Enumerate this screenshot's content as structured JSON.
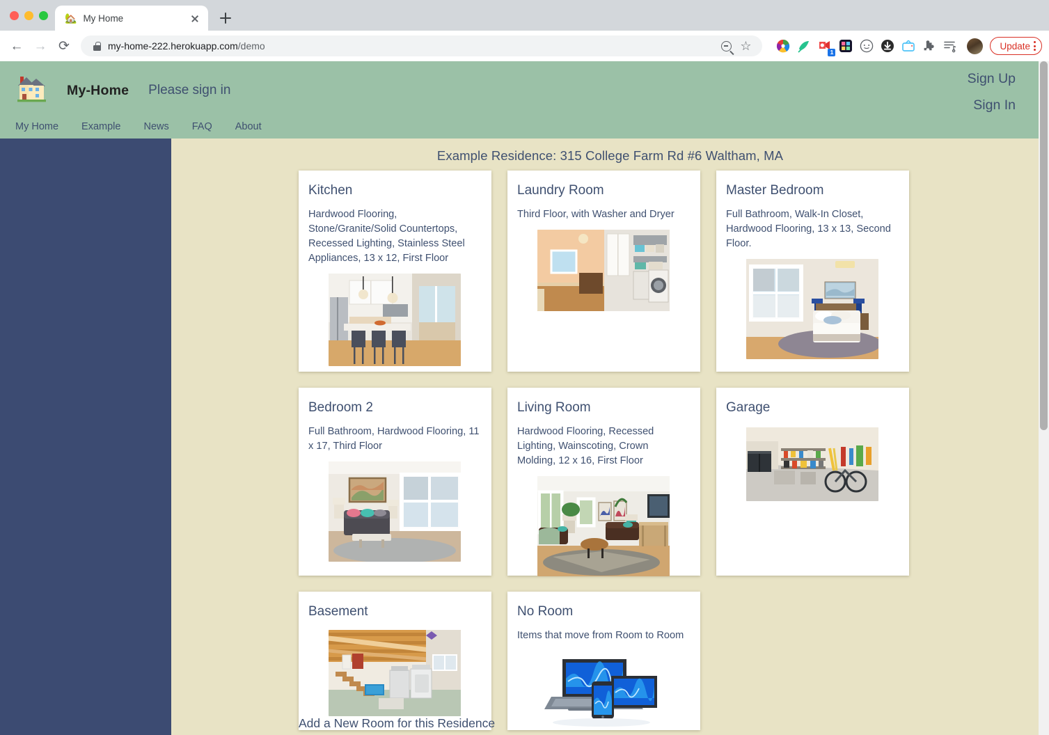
{
  "browser": {
    "tab": {
      "title": "My Home",
      "favicon": "house-icon"
    },
    "new_tab_label": "+",
    "back_label": "←",
    "forward_label": "→",
    "reload_label": "⟳",
    "url_main": "my-home-222.herokuapp.com",
    "url_path": "/demo",
    "update_button": "Update",
    "extensions": [
      "color-wheel-icon",
      "green-bird-icon",
      "red-video-icon",
      "grid-colors-icon",
      "circle-face-icon",
      "download-icon",
      "tv-icon",
      "puzzle-piece-icon",
      "playlist-icon"
    ],
    "extension_badge": "1",
    "avatar": "user-avatar"
  },
  "site": {
    "logo": "house-icon",
    "brand": "My-Home",
    "signin_note": "Please sign in",
    "auth": [
      {
        "label": "Sign Up",
        "name": "sign-up-link"
      },
      {
        "label": "Sign In",
        "name": "sign-in-link"
      }
    ],
    "nav": [
      {
        "label": "My Home",
        "name": "nav-my-home"
      },
      {
        "label": "Example",
        "name": "nav-example"
      },
      {
        "label": "News",
        "name": "nav-news"
      },
      {
        "label": "FAQ",
        "name": "nav-faq"
      },
      {
        "label": "About",
        "name": "nav-about"
      }
    ]
  },
  "main": {
    "page_title": "Example Residence: 315 College Farm Rd #6 Waltham, MA",
    "add_room_link": "Add a New Room for this Residence",
    "rooms": [
      {
        "title": "Kitchen",
        "desc": "Hardwood Flooring, Stone/Granite/Solid Countertops, Recessed Lighting, Stainless Steel Appliances, 13 x 12, First Floor",
        "image": "kitchen-photo"
      },
      {
        "title": "Laundry Room",
        "desc": "Third Floor, with Washer and Dryer",
        "image": "laundry-room-photo"
      },
      {
        "title": "Master Bedroom",
        "desc": "Full Bathroom, Walk-In Closet, Hardwood Flooring, 13 x 13, Second Floor.",
        "image": "master-bedroom-photo"
      },
      {
        "title": "Bedroom 2",
        "desc": "Full Bathroom, Hardwood Flooring, 11 x 17, Third Floor",
        "image": "bedroom-2-photo"
      },
      {
        "title": "Living Room",
        "desc": "Hardwood Flooring, Recessed Lighting, Wainscoting, Crown Molding, 12 x 16, First Floor",
        "image": "living-room-photo"
      },
      {
        "title": "Garage",
        "desc": "",
        "image": "garage-photo"
      },
      {
        "title": "Basement",
        "desc": "",
        "image": "basement-photo"
      },
      {
        "title": "No Room",
        "desc": "Items that move from Room to Room",
        "image": "devices-photo"
      }
    ]
  },
  "colors": {
    "header_green": "#9bc1a7",
    "sidebar_blue": "#3c4b72",
    "page_cream": "#e8e3c5",
    "text_navy": "#3f5070",
    "update_red": "#d93025"
  }
}
